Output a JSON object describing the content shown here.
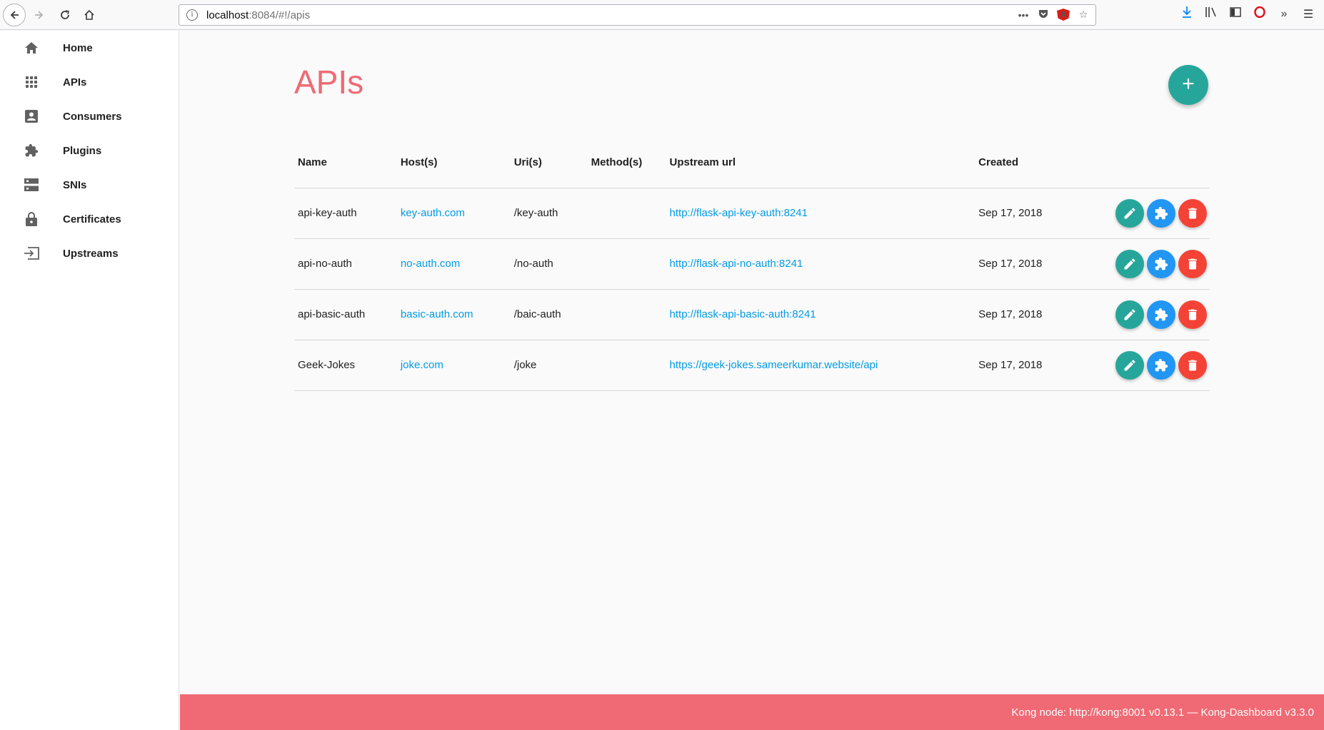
{
  "browser": {
    "url_host": "localhost",
    "url_path": ":8084/#!/apis"
  },
  "sidebar": {
    "items": [
      {
        "label": "Home",
        "icon": "home-icon"
      },
      {
        "label": "APIs",
        "icon": "apps-grid-icon"
      },
      {
        "label": "Consumers",
        "icon": "account-box-icon"
      },
      {
        "label": "Plugins",
        "icon": "extension-icon"
      },
      {
        "label": "SNIs",
        "icon": "dns-icon"
      },
      {
        "label": "Certificates",
        "icon": "lock-icon"
      },
      {
        "label": "Upstreams",
        "icon": "input-icon"
      }
    ]
  },
  "main": {
    "title": "APIs",
    "add_button": "+",
    "table": {
      "headers": [
        "Name",
        "Host(s)",
        "Uri(s)",
        "Method(s)",
        "Upstream url",
        "Created"
      ],
      "rows": [
        {
          "name": "api-key-auth",
          "host": "key-auth.com",
          "uri": "/key-auth",
          "method": "",
          "upstream": "http://flask-api-key-auth:8241",
          "created": "Sep 17, 2018"
        },
        {
          "name": "api-no-auth",
          "host": "no-auth.com",
          "uri": "/no-auth",
          "method": "",
          "upstream": "http://flask-api-no-auth:8241",
          "created": "Sep 17, 2018"
        },
        {
          "name": "api-basic-auth",
          "host": "basic-auth.com",
          "uri": "/baic-auth",
          "method": "",
          "upstream": "http://flask-api-basic-auth:8241",
          "created": "Sep 17, 2018"
        },
        {
          "name": "Geek-Jokes",
          "host": "joke.com",
          "uri": "/joke",
          "method": "",
          "upstream": "https://geek-jokes.sameerkumar.website/api",
          "created": "Sep 17, 2018"
        }
      ]
    }
  },
  "footer": {
    "text": "Kong node: http://kong:8001 v0.13.1 — Kong-Dashboard v3.3.0"
  },
  "colors": {
    "accent": "#ef6a74",
    "edit": "#26a69a",
    "plugin": "#2196f3",
    "delete": "#f44336",
    "link": "#039be5"
  }
}
